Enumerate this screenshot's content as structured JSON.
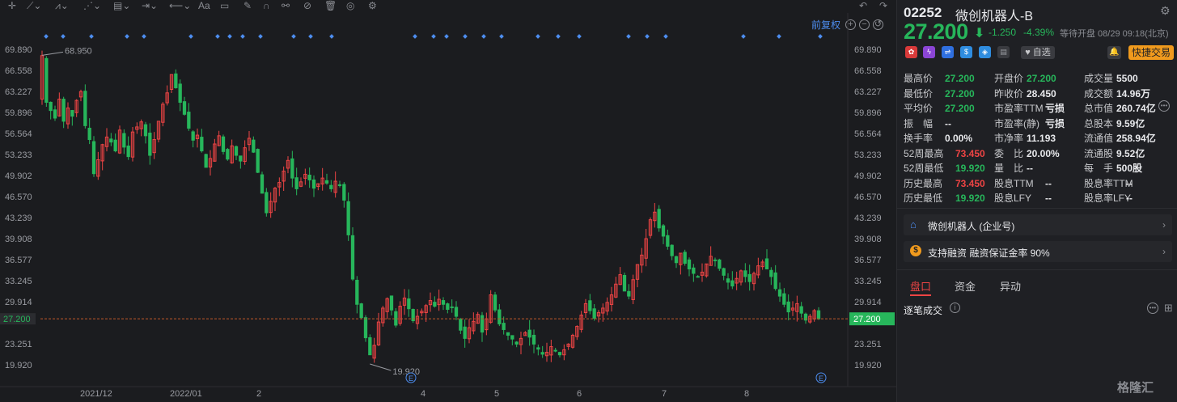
{
  "toolbar": {
    "icons": [
      "crosshair-icon",
      "line-tool-icon",
      "pen-tool-icon",
      "fib-tool-icon",
      "measure-icon",
      "range-icon",
      "arrow-tool-icon",
      "text-tool-icon",
      "comment-icon",
      "pen-icon",
      "magnet-icon",
      "link-icon",
      "hide-icon",
      "trash-icon",
      "eye-icon",
      "settings-icon"
    ],
    "text_tool_label": "Aa"
  },
  "chart": {
    "adjust_label": "前复权",
    "high_label": "68.950",
    "low_label": "19.920",
    "current_price_tag": "27.200",
    "event_marker": "E"
  },
  "chart_data": {
    "type": "candlestick",
    "title": "",
    "x_tick_labels": [
      "2021/12",
      "2022/01",
      "2",
      "4",
      "5",
      "6",
      "7",
      "8"
    ],
    "y_tick_labels": [
      "69.890",
      "66.558",
      "63.227",
      "59.896",
      "56.564",
      "53.233",
      "49.902",
      "46.570",
      "43.239",
      "39.908",
      "36.577",
      "33.245",
      "29.914",
      "27.200",
      "23.251",
      "19.920"
    ],
    "y_ticks": [
      69.89,
      66.558,
      63.227,
      59.896,
      56.564,
      53.233,
      49.902,
      46.57,
      43.239,
      39.908,
      36.577,
      33.245,
      29.914,
      23.251,
      19.92
    ],
    "ylim": [
      18.5,
      72.0
    ],
    "current_price": 27.2,
    "period_high": 68.95,
    "period_low": 19.92,
    "up_color": "#ee4444",
    "down_color": "#27b65b",
    "price_line_color": "#c0552a",
    "closes": [
      68.9,
      61.5,
      60.2,
      59.0,
      62.0,
      58.5,
      60.6,
      59.3,
      61.8,
      63.2,
      57.8,
      55.6,
      50.2,
      52.4,
      54.8,
      56.0,
      55.2,
      53.8,
      57.1,
      54.4,
      52.9,
      56.8,
      57.6,
      58.4,
      56.2,
      53.1,
      55.6,
      58.5,
      61.2,
      63.0,
      65.9,
      63.8,
      61.5,
      59.6,
      57.4,
      55.5,
      56.3,
      53.8,
      51.2,
      52.6,
      54.9,
      56.2,
      53.7,
      52.5,
      54.6,
      53.1,
      52.2,
      54.3,
      55.8,
      53.6,
      50.4,
      47.1,
      44.0,
      45.8,
      47.9,
      48.8,
      50.6,
      52.3,
      49.5,
      47.8,
      48.9,
      50.1,
      49.2,
      47.9,
      48.6,
      49.5,
      48.7,
      47.8,
      49.0,
      48.3,
      46.0,
      40.5,
      33.5,
      29.5,
      27.4,
      24.2,
      21.5,
      23.0,
      26.7,
      28.9,
      30.4,
      28.6,
      26.2,
      29.2,
      30.5,
      28.8,
      26.9,
      27.6,
      28.4,
      29.3,
      30.1,
      29.2,
      30.3,
      29.5,
      28.7,
      29.0,
      27.6,
      25.4,
      24.1,
      25.8,
      26.8,
      27.9,
      25.1,
      27.2,
      31.0,
      28.6,
      26.4,
      25.5,
      24.6,
      24.0,
      23.2,
      24.1,
      25.0,
      24.3,
      23.2,
      22.4,
      21.6,
      21.9,
      22.8,
      22.1,
      21.5,
      22.3,
      23.2,
      24.6,
      26.0,
      27.8,
      29.6,
      28.5,
      27.3,
      28.2,
      28.9,
      29.8,
      31.0,
      32.7,
      34.2,
      31.6,
      30.8,
      33.4,
      35.8,
      37.3,
      39.9,
      42.9,
      44.1,
      41.6,
      40.3,
      38.7,
      37.2,
      36.1,
      37.6,
      36.0,
      35.1,
      34.4,
      33.8,
      34.6,
      35.9,
      37.1,
      36.4,
      35.2,
      34.1,
      33.0,
      32.4,
      33.6,
      34.8,
      33.9,
      33.1,
      34.4,
      35.6,
      36.2,
      35.1,
      33.9,
      32.0,
      30.8,
      29.5,
      28.3,
      28.9,
      29.6,
      28.1,
      27.0,
      27.6,
      28.5,
      27.2
    ]
  },
  "quote": {
    "code": "02252",
    "name": "微创机器人-B",
    "price": "27.200",
    "arrow": "⬇",
    "change": "-1.250",
    "change_pct": "-4.39%",
    "status": "等待开盘 08/29 09:18(北京)",
    "fav_label": "自选",
    "trade_label": "快捷交易"
  },
  "stats": {
    "col1": [
      {
        "label": "最高价",
        "value": "27.200",
        "tone": "g"
      },
      {
        "label": "最低价",
        "value": "27.200",
        "tone": "g"
      },
      {
        "label": "平均价",
        "value": "27.200",
        "tone": "g"
      },
      {
        "label": "振　幅",
        "value": "--",
        "tone": "w"
      },
      {
        "label": "换手率",
        "value": "0.00%",
        "tone": "w"
      },
      {
        "label": "52周最高",
        "value": "73.450",
        "tone": "r"
      },
      {
        "label": "52周最低",
        "value": "19.920",
        "tone": "g"
      },
      {
        "label": "历史最高",
        "value": "73.450",
        "tone": "r"
      },
      {
        "label": "历史最低",
        "value": "19.920",
        "tone": "g"
      }
    ],
    "col2": [
      {
        "label": "开盘价",
        "value": "27.200",
        "tone": "g"
      },
      {
        "label": "昨收价",
        "value": "28.450",
        "tone": "w"
      },
      {
        "label": "市盈率TTM",
        "value": "亏损",
        "tone": "w"
      },
      {
        "label": "市盈率(静)",
        "value": "亏损",
        "tone": "w"
      },
      {
        "label": "市净率",
        "value": "11.193",
        "tone": "w"
      },
      {
        "label": "委　比",
        "value": "20.00%",
        "tone": "w"
      },
      {
        "label": "量　比",
        "value": "--",
        "tone": "w"
      },
      {
        "label": "股息TTM",
        "value": "--",
        "tone": "w"
      },
      {
        "label": "股息LFY",
        "value": "--",
        "tone": "w"
      }
    ],
    "col3": [
      {
        "label": "成交量",
        "value": "5500",
        "tone": "w"
      },
      {
        "label": "成交额",
        "value": "14.96万",
        "tone": "w"
      },
      {
        "label": "总市值",
        "value": "260.74亿",
        "tone": "w"
      },
      {
        "label": "总股本",
        "value": "9.59亿",
        "tone": "w"
      },
      {
        "label": "流通值",
        "value": "258.94亿",
        "tone": "w"
      },
      {
        "label": "流通股",
        "value": "9.52亿",
        "tone": "w"
      },
      {
        "label": "每　手",
        "value": "500股",
        "tone": "w"
      },
      {
        "label": "股息率TTM",
        "value": "--",
        "tone": "w"
      },
      {
        "label": "股息率LFY",
        "value": "--",
        "tone": "w"
      }
    ]
  },
  "corp": {
    "name": "微创机器人 (企业号)"
  },
  "margin": {
    "text": "支持融资 融资保证金率 90%"
  },
  "tabs": [
    "盘口",
    "资金",
    "异动"
  ],
  "trades": {
    "label": "逐笔成交"
  },
  "watermark": "格隆汇"
}
